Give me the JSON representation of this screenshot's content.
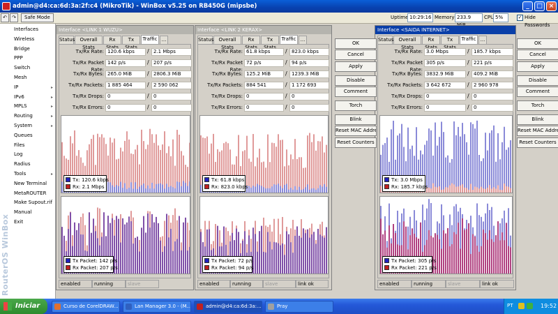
{
  "titlebar": {
    "title": "admin@d4:ca:6d:3a:2f:c4 (MikroTik) - WinBox v5.25 on RB450G (mipsbe)"
  },
  "toolbar": {
    "safe_mode": "Safe Mode",
    "uptime_label": "Uptime",
    "uptime_value": "10:29:16",
    "memory_label": "Memory",
    "memory_value": "233.9 MiB",
    "cpu_label": "CPU",
    "cpu_value": "5%",
    "hide_passwords_label": "Hide Passwords",
    "hide_passwords_checked": true
  },
  "sidebar": {
    "brand": "RouterOS WinBox",
    "items": [
      {
        "label": "Interfaces",
        "submenu": false
      },
      {
        "label": "Wireless",
        "submenu": false
      },
      {
        "label": "Bridge",
        "submenu": false
      },
      {
        "label": "PPP",
        "submenu": false
      },
      {
        "label": "Switch",
        "submenu": false
      },
      {
        "label": "Mesh",
        "submenu": false
      },
      {
        "label": "IP",
        "submenu": true
      },
      {
        "label": "IPv6",
        "submenu": true
      },
      {
        "label": "MPLS",
        "submenu": true
      },
      {
        "label": "Routing",
        "submenu": true
      },
      {
        "label": "System",
        "submenu": true
      },
      {
        "label": "Queues",
        "submenu": false
      },
      {
        "label": "Files",
        "submenu": false
      },
      {
        "label": "Log",
        "submenu": false
      },
      {
        "label": "Radius",
        "submenu": false
      },
      {
        "label": "Tools",
        "submenu": true
      },
      {
        "label": "New Terminal",
        "submenu": false
      },
      {
        "label": "MetaROUTER",
        "submenu": false
      },
      {
        "label": "Make Supout.rif",
        "submenu": false
      },
      {
        "label": "Manual",
        "submenu": false
      },
      {
        "label": "Exit",
        "submenu": false
      }
    ]
  },
  "colors": {
    "tx": "#2020c0",
    "rx": "#c02020",
    "tx_bar": "#8a8ad8",
    "rx_bar": "#e09a9a"
  },
  "panels": [
    {
      "title": "Interface <LINK 1 WUZU>",
      "active": false,
      "tabs": [
        "Status",
        "Overall Stats",
        "Rx Stats",
        "Tx Stats",
        "Traffic",
        "..."
      ],
      "selected_tab": "Traffic",
      "fields": [
        {
          "label": "Tx/Rx Rate:",
          "tx": "120.6 kbps",
          "rx": "2.1 Mbps"
        },
        {
          "label": "Tx/Rx Packet Rate:",
          "tx": "142 p/s",
          "rx": "207 p/s"
        },
        {
          "label": "Tx/Rx Bytes:",
          "tx": "265.0 MiB",
          "rx": "2806.3 MiB"
        },
        {
          "label": "Tx/Rx Packets:",
          "tx": "1 885 464",
          "rx": "2 590 062"
        },
        {
          "label": "Tx/Rx Drops:",
          "tx": "0",
          "rx": "0"
        },
        {
          "label": "Tx/Rx Errors:",
          "tx": "0",
          "rx": "0"
        }
      ],
      "legend_rate": {
        "tx": "Tx:  120.6 kbps",
        "rx": "Rx:  2.1 Mbps"
      },
      "legend_packet": {
        "tx": "Tx Packet:  142 p/s",
        "rx": "Rx Packet:  207 p/s"
      },
      "graph_levels": {
        "rate_rx": 0.62,
        "rate_tx": 0.12,
        "packet_rx": 0.65,
        "packet_tx": 0.58
      },
      "status": [
        "enabled",
        "running",
        "slave"
      ]
    },
    {
      "title": "Interface <LINK 2 KERAX>",
      "active": false,
      "tabs": [
        "Status",
        "Overall Stats",
        "Rx Stats",
        "Tx Stats",
        "Traffic",
        "..."
      ],
      "selected_tab": "Traffic",
      "fields": [
        {
          "label": "Tx/Rx Rate:",
          "tx": "61.8 kbps",
          "rx": "823.0 kbps"
        },
        {
          "label": "Tx/Rx Packet Rate:",
          "tx": "72 p/s",
          "rx": "94 p/s"
        },
        {
          "label": "Tx/Rx Bytes:",
          "tx": "125.2 MiB",
          "rx": "1239.3 MiB"
        },
        {
          "label": "Tx/Rx Packets:",
          "tx": "884 541",
          "rx": "1 172 693"
        },
        {
          "label": "Tx/Rx Drops:",
          "tx": "0",
          "rx": "0"
        },
        {
          "label": "Tx/Rx Errors:",
          "tx": "0",
          "rx": "0"
        }
      ],
      "legend_rate": {
        "tx": "Tx:  61.8 kbps",
        "rx": "Rx:  823.0 kbps"
      },
      "legend_packet": {
        "tx": "Tx Packet:  72 p/s",
        "rx": "Rx Packet:  94 p/s"
      },
      "graph_levels": {
        "rate_rx": 0.58,
        "rate_tx": 0.1,
        "packet_rx": 0.55,
        "packet_tx": 0.45
      },
      "status": [
        "enabled",
        "running",
        "slave",
        "link ok"
      ]
    },
    {
      "title": "Interface <SAIDA INTERNET>",
      "active": true,
      "tabs": [
        "Status",
        "Overall Stats",
        "Rx Stats",
        "Tx Stats",
        "Traffic",
        "..."
      ],
      "selected_tab": "Traffic",
      "fields": [
        {
          "label": "Tx/Rx Rate:",
          "tx": "3.0 Mbps",
          "rx": "185.7 kbps"
        },
        {
          "label": "Tx/Rx Packet Rate:",
          "tx": "305 p/s",
          "rx": "221 p/s"
        },
        {
          "label": "Tx/Rx Bytes:",
          "tx": "3832.9 MiB",
          "rx": "409.2 MiB"
        },
        {
          "label": "Tx/Rx Packets:",
          "tx": "3 642 672",
          "rx": "2 960 978"
        },
        {
          "label": "Tx/Rx Drops:",
          "tx": "0",
          "rx": "0"
        },
        {
          "label": "Tx/Rx Errors:",
          "tx": "0",
          "rx": "0"
        }
      ],
      "legend_rate": {
        "tx": "Tx:  3.0 Mbps",
        "rx": "Rx:  185.7 kbps"
      },
      "legend_packet": {
        "tx": "Tx Packet:  305 p/s",
        "rx": "Rx Packet:  221 p/s"
      },
      "graph_levels": {
        "rate_tx": 0.7,
        "rate_rx": 0.1,
        "packet_tx": 0.72,
        "packet_rx": 0.52
      },
      "status": [
        "enabled",
        "running",
        "slave",
        "link ok"
      ]
    }
  ],
  "button_column_mid": [
    "OK",
    "Cancel",
    "Apply",
    "Disable",
    "Comment",
    "Torch",
    "Blink",
    "Reset MAC Address",
    "Reset Counters"
  ],
  "button_column_right": [
    "OK",
    "Cancel",
    "Apply",
    "Disable",
    "Comment",
    "Torch",
    "Blink",
    "Reset MAC Address",
    "Reset Counters"
  ],
  "taskbar": {
    "start": "Iniciar",
    "tasks": [
      {
        "label": "Curso de CorelDRAW..."
      },
      {
        "label": "Lan Manager 3.0 - (M..."
      },
      {
        "label": "admin@d4:ca:6d:3a:..."
      },
      {
        "label": "Pray"
      }
    ],
    "lang": "PT",
    "clock": "19:52"
  }
}
